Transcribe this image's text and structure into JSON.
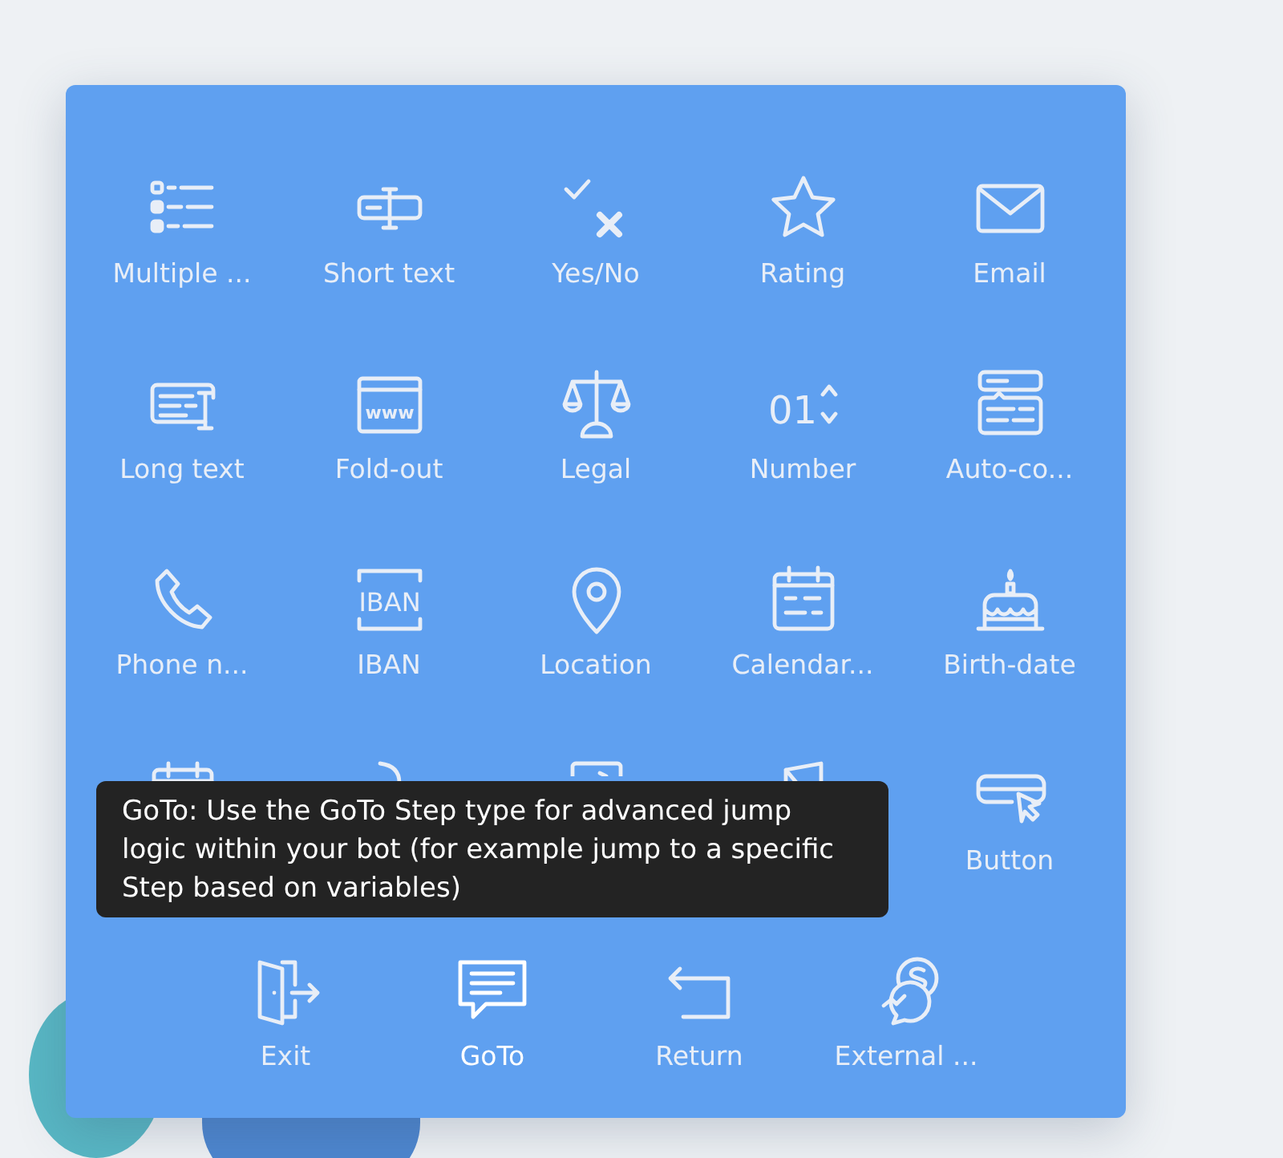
{
  "rows": [
    {
      "items": [
        {
          "kind": "choice",
          "label": "Multiple ...",
          "selected": false
        },
        {
          "kind": "short-text",
          "label": "Short text",
          "selected": false
        },
        {
          "kind": "yes-no",
          "label": "Yes/No",
          "selected": false
        },
        {
          "kind": "star",
          "label": "Rating",
          "selected": false
        },
        {
          "kind": "email",
          "label": "Email",
          "selected": false
        }
      ]
    },
    {
      "items": [
        {
          "kind": "long-text",
          "label": "Long text",
          "selected": false
        },
        {
          "kind": "browser",
          "label": "Fold-out",
          "icon_text": "www",
          "selected": false
        },
        {
          "kind": "scale",
          "label": "Legal",
          "selected": false
        },
        {
          "kind": "number",
          "label": "Number",
          "icon_text": "01",
          "selected": false
        },
        {
          "kind": "autocomplete",
          "label": "Auto-co...",
          "selected": false
        }
      ]
    },
    {
      "items": [
        {
          "kind": "phone",
          "label": "Phone n...",
          "selected": false
        },
        {
          "kind": "iban",
          "label": "IBAN",
          "icon_text": "IBAN",
          "selected": false
        },
        {
          "kind": "location",
          "label": "Location",
          "selected": false
        },
        {
          "kind": "calendar",
          "label": "Calendar...",
          "selected": false
        },
        {
          "kind": "cake",
          "label": "Birth-date",
          "selected": false
        }
      ]
    },
    {
      "items": [
        {
          "kind": "calendar-partial",
          "selected": false
        },
        {
          "kind": "curve-partial",
          "selected": false
        },
        {
          "kind": "square-partial",
          "selected": false
        },
        {
          "kind": "document-partial",
          "selected": false
        },
        {
          "kind": "button",
          "label": "Button",
          "selected": false
        }
      ]
    },
    {
      "items": [
        {
          "kind": "exit",
          "label": "Exit",
          "selected": false
        },
        {
          "kind": "chat",
          "label": "GoTo",
          "selected": true
        },
        {
          "kind": "return",
          "label": "Return",
          "selected": false
        },
        {
          "kind": "messengers",
          "label": "External ...",
          "selected": false
        }
      ]
    }
  ],
  "tooltip": {
    "text": "GoTo: Use the GoTo Step type for advanced jump logic within your bot (for example jump to a specific Step based on variables)"
  }
}
